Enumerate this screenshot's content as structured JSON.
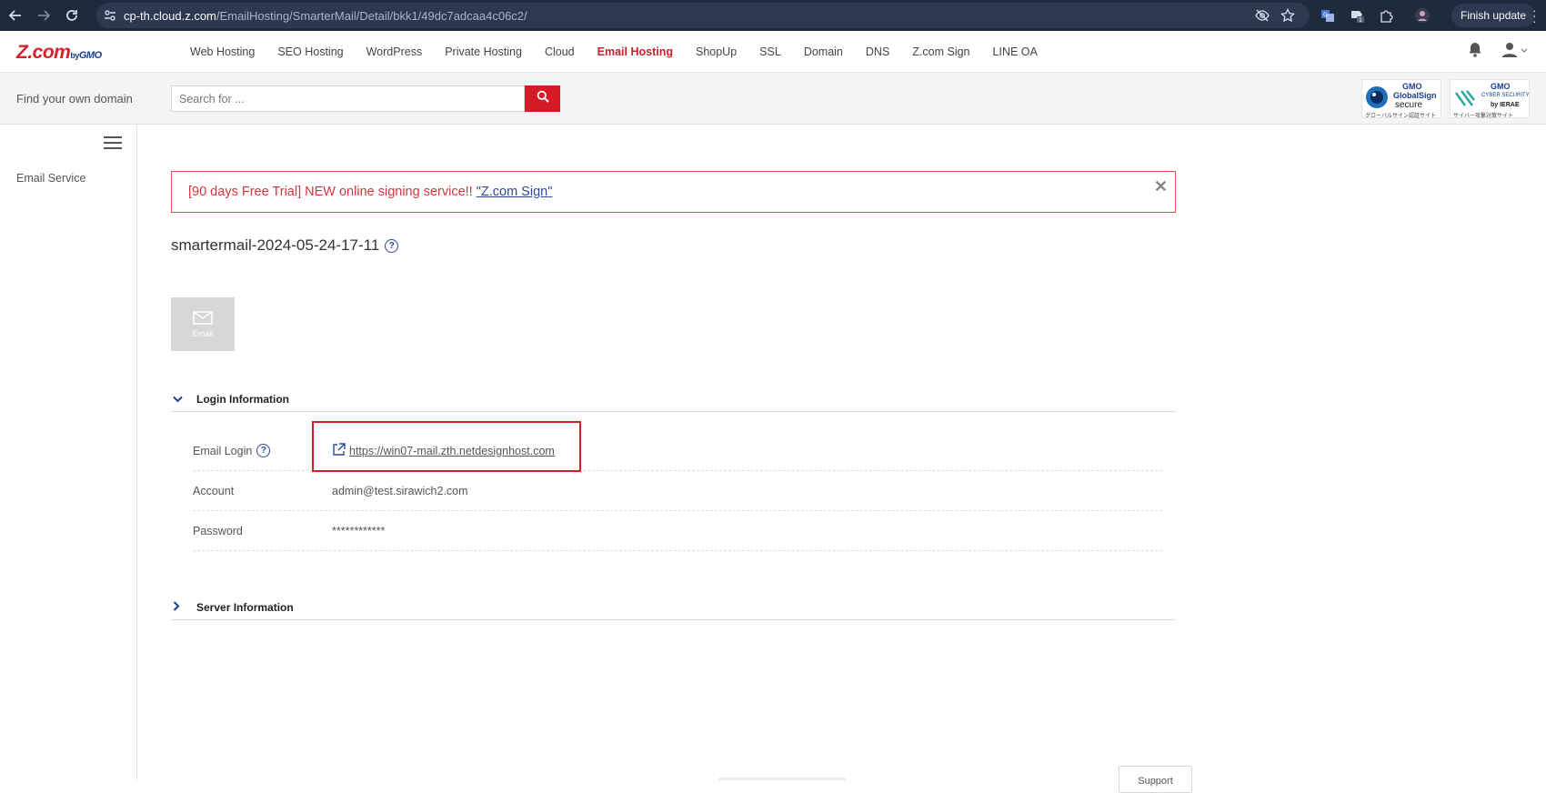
{
  "browser": {
    "url_host": "cp-th.cloud.z.com",
    "url_path": "/EmailHosting/SmarterMail/Detail/bkk1/49dc7adcaa4c06c2/",
    "finish_update_label": "Finish update",
    "extension_badge_count": "1"
  },
  "header": {
    "logo_text": "Z.com",
    "logo_by": "by",
    "logo_gmo": "GMO",
    "nav_items": [
      {
        "label": "Web Hosting"
      },
      {
        "label": "SEO Hosting"
      },
      {
        "label": "WordPress"
      },
      {
        "label": "Private Hosting"
      },
      {
        "label": "Cloud"
      },
      {
        "label": "Email Hosting",
        "active": true
      },
      {
        "label": "ShopUp"
      },
      {
        "label": "SSL"
      },
      {
        "label": "Domain"
      },
      {
        "label": "DNS"
      },
      {
        "label": "Z.com Sign"
      },
      {
        "label": "LINE OA"
      }
    ]
  },
  "search": {
    "label": "Find your own domain",
    "placeholder": "Search for ..."
  },
  "badges": {
    "globalsign_gmo": "GMO",
    "globalsign_title": "GlobalSign",
    "globalsign_secure": "secure",
    "globalsign_caption": "グローバルサイン認証サイト",
    "ierae_gmo": "GMO",
    "ierae_title": "CYBER SECURITY",
    "ierae_by": "by IERAE",
    "ierae_caption": "サイバー攻撃対策サイト"
  },
  "sidebar": {
    "items": [
      {
        "label": "Email Service"
      }
    ]
  },
  "promo": {
    "text": "[90 days Free Trial] NEW online signing service!! ",
    "link_text": "\"Z.com Sign\"",
    "close": "✕"
  },
  "page": {
    "title": "smartermail-2024-05-24-17-11",
    "help_glyph": "?",
    "email_tile_label": "Email"
  },
  "login_section": {
    "title": "Login Information",
    "expanded": true,
    "rows": [
      {
        "key": "Email Login",
        "value": "https://win07-mail.zth.netdesignhost.com",
        "is_link": true
      },
      {
        "key": "Account",
        "value": "admin@test.sirawich2.com"
      },
      {
        "key": "Password",
        "value": "************"
      }
    ]
  },
  "server_section": {
    "title": "Server Information",
    "expanded": false
  },
  "support": {
    "label": "Support"
  },
  "colors": {
    "brand_red": "#d71a28",
    "brand_blue": "#1a3f8f",
    "browser_bg": "#1f2a3d"
  }
}
